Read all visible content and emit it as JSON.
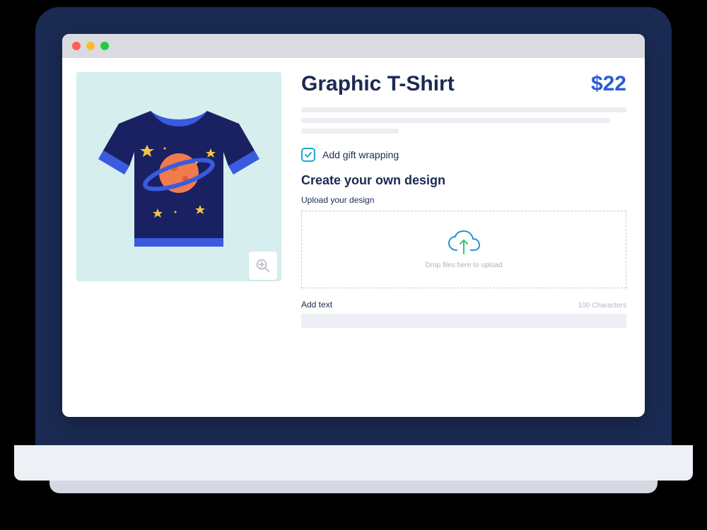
{
  "product": {
    "title": "Graphic T-Shirt",
    "price": "$22"
  },
  "gift": {
    "label": "Add gift wrapping",
    "checked": true
  },
  "custom": {
    "section_title": "Create your own design",
    "upload_label": "Upload your design",
    "drop_text": "Drop files here to upload",
    "addtext_label": "Add text",
    "char_hint": "100 Characters",
    "text_value": ""
  },
  "icons": {
    "zoom": "zoom-in-icon",
    "cloud": "cloud-upload-icon",
    "check": "check-icon"
  },
  "colors": {
    "bezel": "#1a2a52",
    "accent_blue": "#2b5bd7",
    "teal": "#21a7d0",
    "green": "#33c481"
  }
}
